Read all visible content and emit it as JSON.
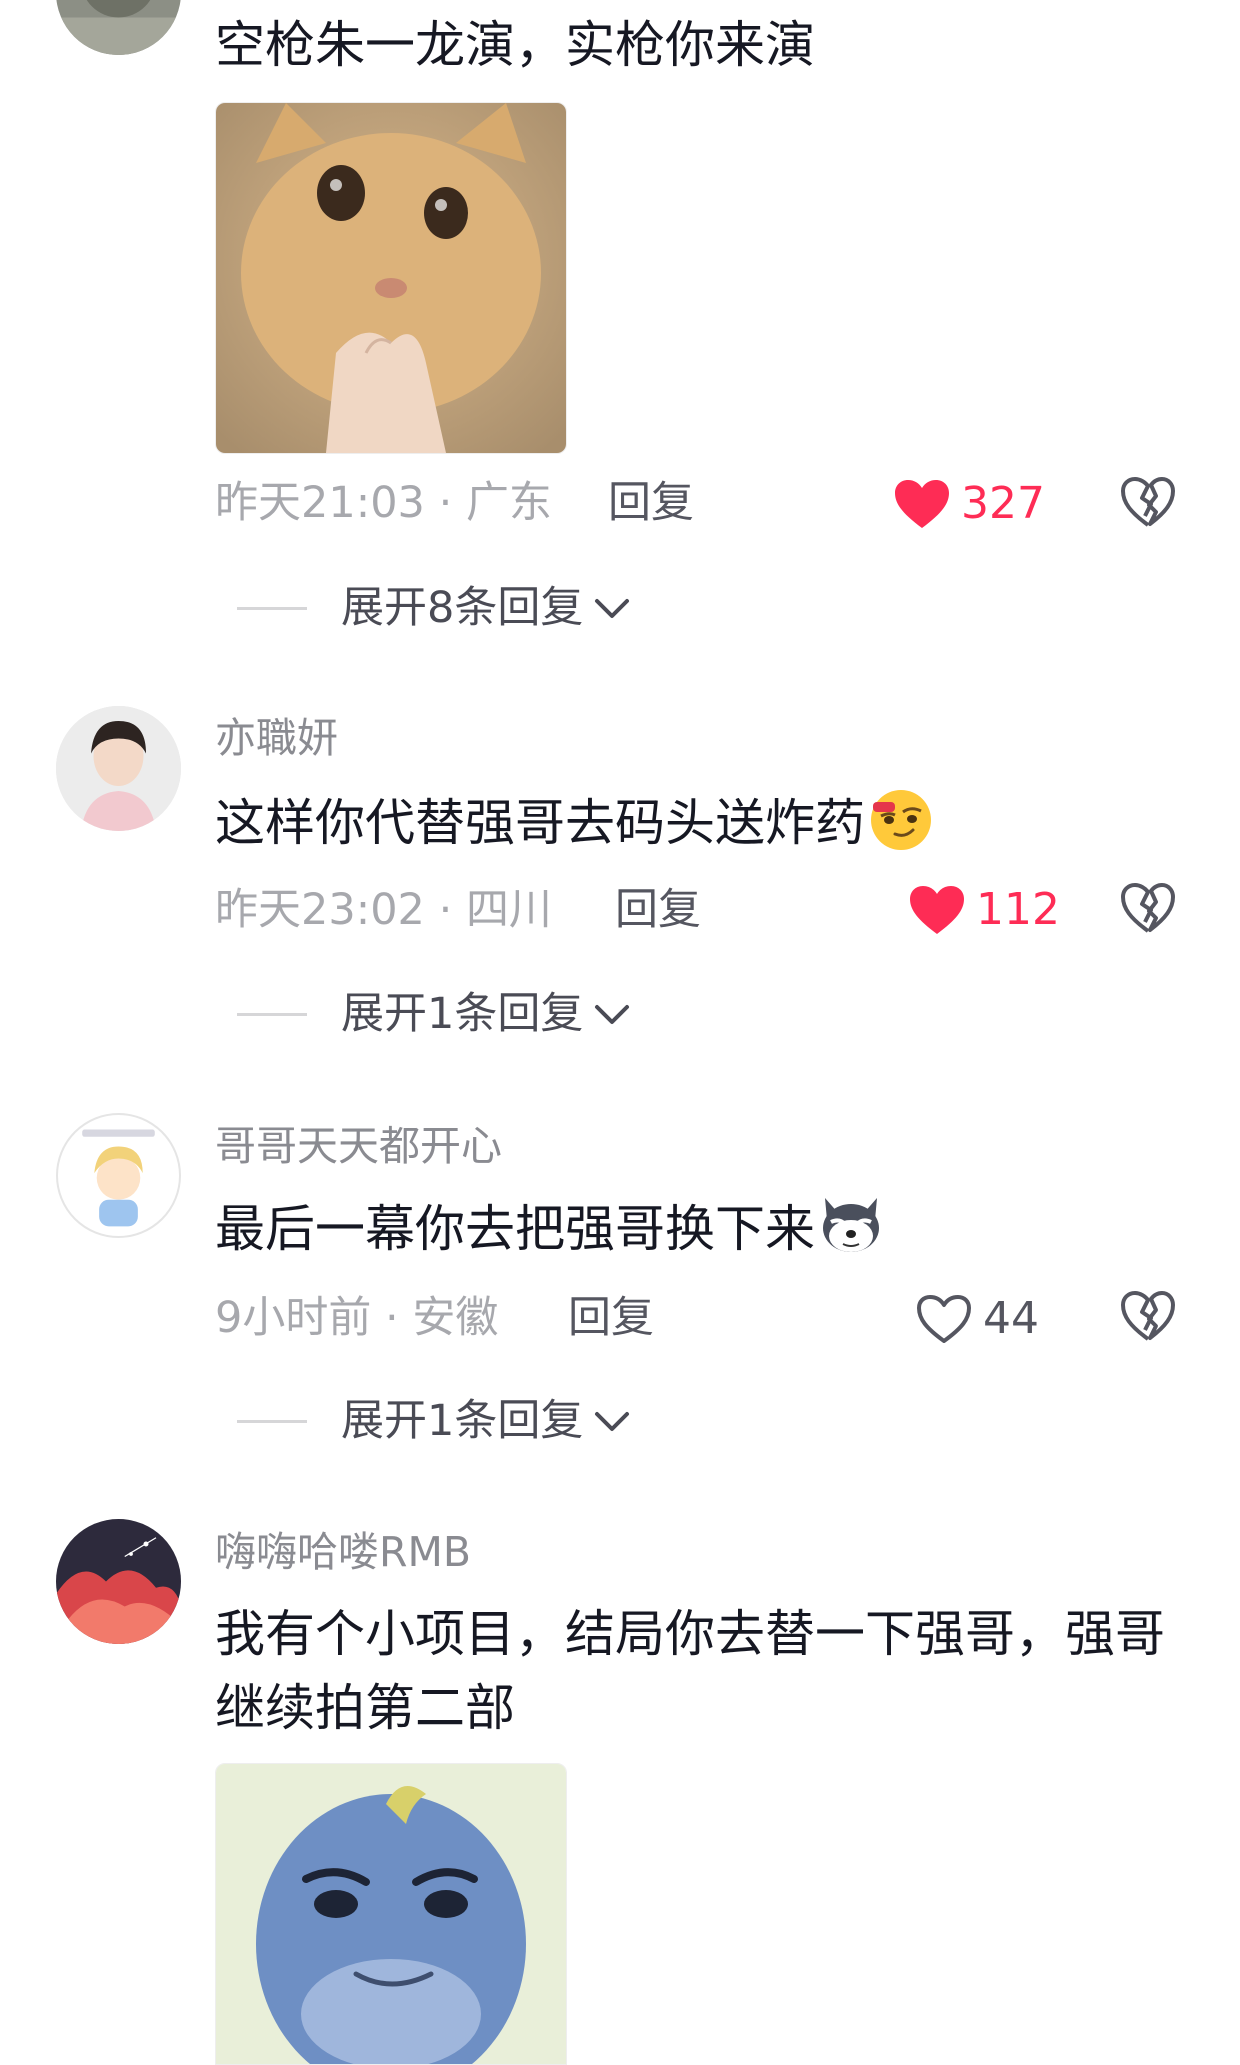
{
  "comments": [
    {
      "username": "",
      "text": "空枪朱一龙演，实枪你来演",
      "has_sticker": true,
      "sticker": "cat-thinking-sticker",
      "time": "昨天21:03",
      "location": "广东",
      "reply_label": "回复",
      "likes": "327",
      "liked": true,
      "expand_label": "展开8条回复"
    },
    {
      "username": "亦職妍",
      "text": "这样你代替强哥去码头送炸药",
      "emoji": "smirk-emoji",
      "time": "昨天23:02",
      "location": "四川",
      "reply_label": "回复",
      "likes": "112",
      "liked": true,
      "expand_label": "展开1条回复"
    },
    {
      "username": "哥哥天天都开心",
      "text": "最后一幕你去把强哥换下来",
      "emoji": "husky-emoji",
      "time": "9小时前",
      "location": "安徽",
      "reply_label": "回复",
      "likes": "44",
      "liked": false,
      "expand_label": "展开1条回复"
    },
    {
      "username": "嗨嗨哈喽RMB",
      "text": "我有个小项目，结局你去替一下强哥，强哥继续拍第二部",
      "has_sticker": true,
      "sticker": "blue-dolphin-sticker"
    }
  ],
  "separator": " · ",
  "colors": {
    "like_active": "#fe2c55",
    "meta_text": "#a7a8ad",
    "username_text": "#8a8b91",
    "body_text": "#161823"
  }
}
